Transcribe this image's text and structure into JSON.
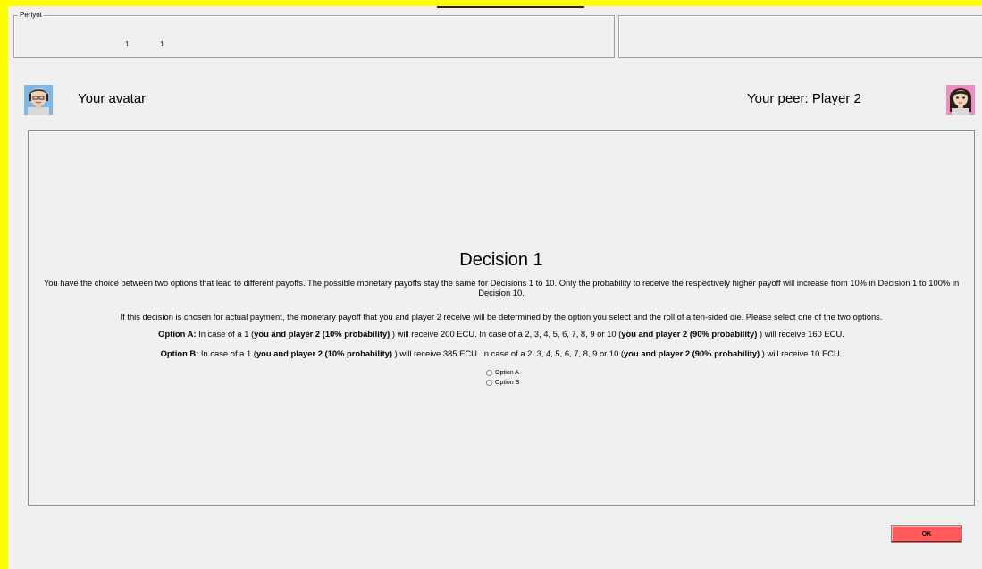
{
  "period": {
    "legend": "Periyot",
    "value1": "1",
    "value2": "1"
  },
  "players": {
    "self_label": "Your avatar",
    "peer_label": "Your peer: Player 2"
  },
  "decision": {
    "title": "Decision 1",
    "intro": "You have the choice between two options that lead to different payoffs. The possible monetary payoffs stay the same for Decisions 1 to 10. Only the probability to receive the respectively higher payoff will increase from 10% in Decision 1 to 100% in Decision 10.",
    "instruction": "If this decision is chosen for actual payment, the monetary payoff that you and player 2 receive will be determined by the option you select and the roll of a ten-sided die. Please select one of the two options.",
    "option_a": {
      "label": "Option A:",
      "text1": " In case of a 1 (",
      "bold1": "you and player 2 (10% probability)",
      "text2": " ) will receive 200 ECU. In case of a 2, 3, 4, 5, 6, 7, 8, 9 or 10 (",
      "bold2": "you and player 2 (90% probability)",
      "text3": " ) will receive 160 ECU."
    },
    "option_b": {
      "label": "Option B:",
      "text1": " In case of a 1 (",
      "bold1": "you and player 2 (10% probability)",
      "text2": " ) will receive 385 ECU. In case of a 2, 3, 4, 5, 6, 7, 8, 9 or 10 (",
      "bold2": "you and player 2 (90% probability)",
      "text3": " ) will receive 10 ECU."
    },
    "radio": {
      "a_label": "Option A",
      "b_label": "Option B"
    }
  },
  "ok_button": {
    "label": "OK",
    "color": "#ff5b5b"
  },
  "colors": {
    "screen_border": "#ffff00",
    "panel_bg": "#f0f0f0"
  },
  "icons": {
    "self_avatar": "male-avatar-icon",
    "peer_avatar": "female-avatar-icon"
  }
}
